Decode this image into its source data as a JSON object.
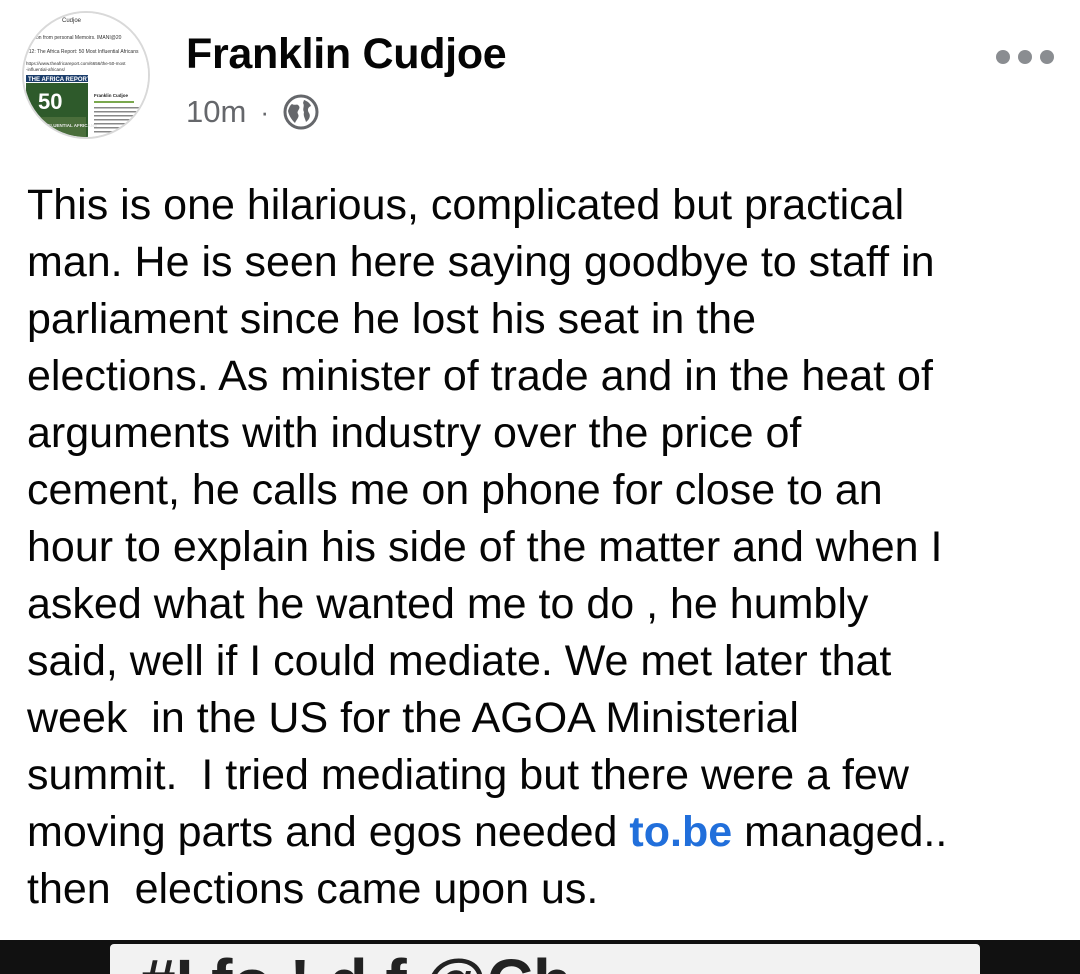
{
  "post": {
    "author": "Franklin Cudjoe",
    "time": "10m",
    "separator": "·",
    "privacy_icon": "globe-icon",
    "more_icon": "more-options-icon",
    "body_lines": [
      "This is one hilarious, complicated but practical",
      "man. He is seen here saying goodbye to staff in",
      "parliament since he lost his seat in the",
      "elections. As minister of trade and in the heat of",
      "arguments with industry over the price of",
      "cement, he calls me on phone for close to an",
      "hour to explain his side of the matter and when I",
      "asked what he wanted me to do , he humbly",
      "said, well if I could mediate. We met later that",
      "week  in the US for the AGOA Ministerial",
      "summit.  I tried mediating but there were a few"
    ],
    "body_line12_pre": "moving parts and egos needed ",
    "body_link": "to.be",
    "body_line12_post": " managed..",
    "body_last": "then  elections came upon us.",
    "link_color": "#216fdb"
  },
  "avatar": {
    "name_text": "Cudjoe",
    "line1": "llection from personal Memoirs. IMANI@20",
    "line2": "012: The Africa Report: 50 Most Influential Africans",
    "line3": "https://www.theafricareport.com/6656/the-50-most",
    "line4": "-influential-africans/",
    "magazine_title": "THE AFRICA REPORT",
    "magazine_number": "50",
    "magazine_sub": "MOST INFLUENTIAL AFRICANS",
    "article_name": "Franklin Cudjoe"
  },
  "media_preview": {
    "text": "#I fo  ! d f  @Ch"
  }
}
